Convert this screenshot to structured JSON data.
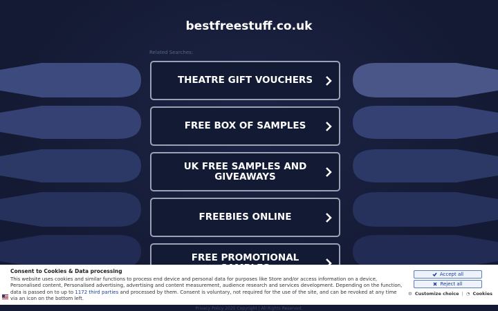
{
  "site": {
    "title": "bestfreestuff.co.uk",
    "related_label": "Related Searches:"
  },
  "searches": [
    "THEATRE GIFT VOUCHERS",
    "FREE BOX OF SAMPLES",
    "UK FREE SAMPLES AND GIVEAWAYS",
    "FREEBIES ONLINE",
    "FREE PROMOTIONAL SAMPLES"
  ],
  "consent": {
    "title": "Consent to Cookies & Data processing",
    "text_part1": "This website uses cookies and similar functions to process end device and personal data for purposes like Store and/or access information on a device, Personalised content, Personalised advertising, advertising and content measurement, audience research and services development. Depending on the function, data is passed on to up to ",
    "third_parties_link": "1172 third parties",
    "text_part2": " and processed by them. Consent is voluntary, not required for the use of the site, and can be revoked at any time via an icon on the bottom left.",
    "accept_label": "Accept all",
    "reject_label": "Reject all",
    "customize_label": "Customize choice",
    "separator": "|",
    "cookies_label": "Cookies"
  },
  "footer": {
    "privacy_label": "Privacy Policy",
    "copyright": "2025 Copyright | All Rights Reserved."
  },
  "colors": {
    "background": "#141a33",
    "button_border": "#9aa2b4",
    "accent": "#1a3c9c"
  }
}
